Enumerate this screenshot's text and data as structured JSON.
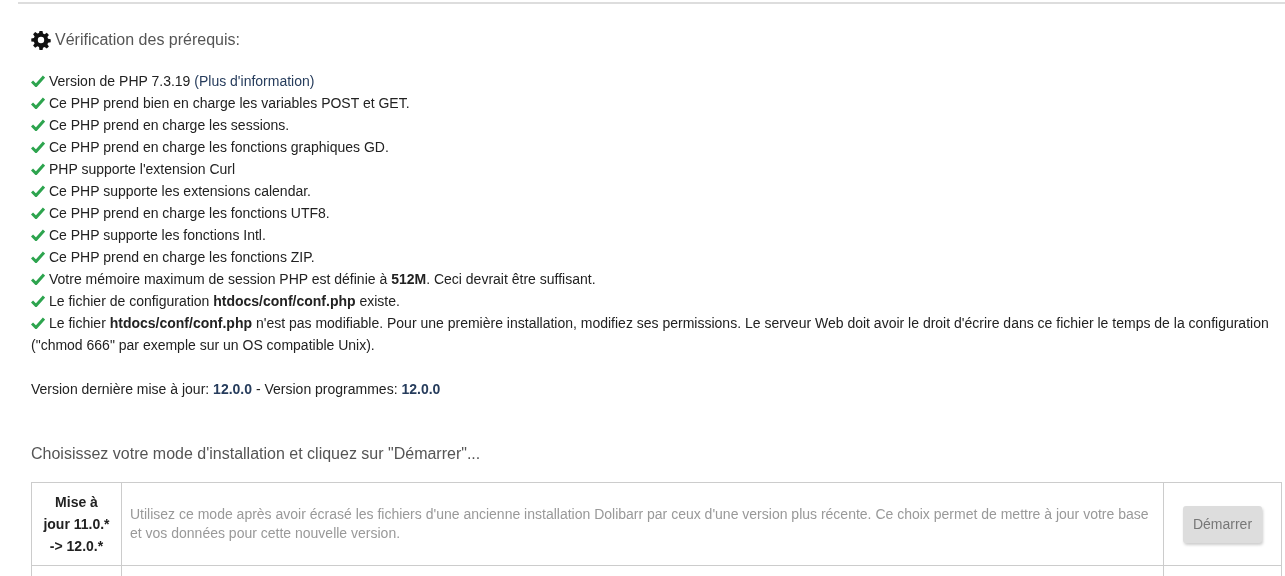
{
  "title": "Vérification des prérequis:",
  "checks": [
    {
      "ok": true,
      "text": "Version de PHP 7.3.19",
      "link": "(Plus d'information)"
    },
    {
      "ok": true,
      "text": "Ce PHP prend bien en charge les variables POST et GET."
    },
    {
      "ok": true,
      "text": "Ce PHP prend en charge les sessions."
    },
    {
      "ok": true,
      "text": "Ce PHP prend en charge les fonctions graphiques GD."
    },
    {
      "ok": true,
      "text": "PHP supporte l'extension Curl"
    },
    {
      "ok": true,
      "text": "Ce PHP supporte les extensions calendar."
    },
    {
      "ok": true,
      "text": "Ce PHP prend en charge les fonctions UTF8."
    },
    {
      "ok": true,
      "text": "Ce PHP supporte les fonctions Intl."
    },
    {
      "ok": true,
      "text": "Ce PHP prend en charge les fonctions ZIP."
    },
    {
      "ok": true,
      "text": "Votre mémoire maximum de session PHP est définie à **512M**. Ceci devrait être suffisant."
    },
    {
      "ok": true,
      "text": "Le fichier de configuration **htdocs/conf/conf.php** existe."
    },
    {
      "ok": true,
      "text": "Le fichier **htdocs/conf/conf.php** n'est pas modifiable. Pour une première installation, modifiez ses permissions. Le serveur Web doit avoir le droit d'écrire dans ce fichier le temps de la configuration (\"chmod 666\" par exemple sur un OS compatible Unix)."
    }
  ],
  "version_line": "Version dernière mise à jour: **12.0.0** - Version programmes: **12.0.0**",
  "choose_prompt": "Choisissez votre mode d'installation et cliquez sur \"Démarrer\"...",
  "modes": [
    {
      "name": "Mise à jour 11.0.* -> 12.0.*",
      "description": "Utilisez ce mode après avoir écrasé les fichiers d'une ancienne installation Dolibarr par ceux d'une version plus récente. Ce choix permet de mettre à jour votre base et vos données pour cette nouvelle version.",
      "button": "Démarrer",
      "disabled": true
    }
  ]
}
